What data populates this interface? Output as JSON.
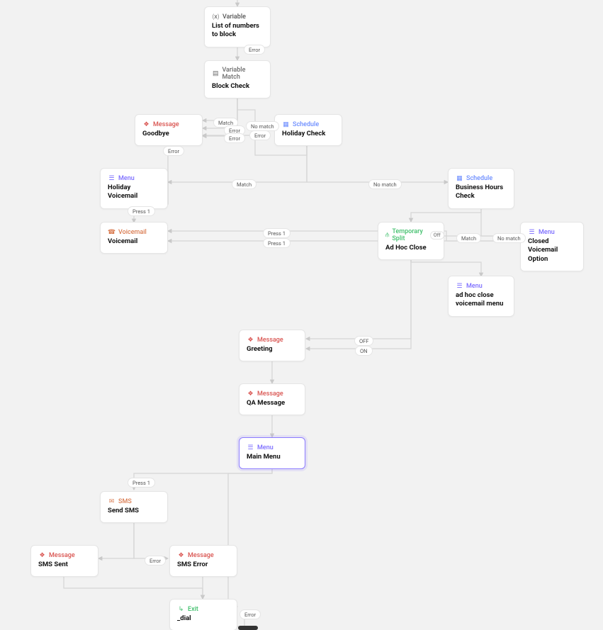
{
  "nodes": {
    "var": {
      "type": "Variable",
      "title": "List of numbers to block",
      "typeClass": "c-variable",
      "icon": "variable-icon"
    },
    "vmatch": {
      "type": "Variable Match",
      "title": "Block Check",
      "typeClass": "c-vmatch",
      "icon": "vmatch-icon"
    },
    "goodbye": {
      "type": "Message",
      "title": "Goodbye",
      "typeClass": "c-message",
      "icon": "message-icon"
    },
    "holiday": {
      "type": "Schedule",
      "title": "Holiday Check",
      "typeClass": "c-schedule",
      "icon": "schedule-icon"
    },
    "hvm": {
      "type": "Menu",
      "title": "Holiday Voicemail",
      "typeClass": "c-menu",
      "icon": "menu-icon"
    },
    "bhc": {
      "type": "Schedule",
      "title": "Business Hours Check",
      "typeClass": "c-schedule",
      "icon": "schedule-icon"
    },
    "vm": {
      "type": "Voicemail",
      "title": "Voicemail",
      "typeClass": "c-voicemail",
      "icon": "voicemail-icon"
    },
    "adhoc": {
      "type": "Temporary Split",
      "title": "Ad Hoc Close",
      "typeClass": "c-split",
      "icon": "split-icon",
      "toggle": "Off"
    },
    "cvo": {
      "type": "Menu",
      "title": "Closed Voicemail Option",
      "typeClass": "c-menu",
      "icon": "menu-icon"
    },
    "adhocmenu": {
      "type": "Menu",
      "title": "ad hoc close voicemail menu",
      "typeClass": "c-menu",
      "icon": "menu-icon"
    },
    "greet": {
      "type": "Message",
      "title": "Greeting",
      "typeClass": "c-message",
      "icon": "message-icon"
    },
    "qa": {
      "type": "Message",
      "title": "QA Message",
      "typeClass": "c-message",
      "icon": "message-icon"
    },
    "main": {
      "type": "Menu",
      "title": "Main Menu",
      "typeClass": "c-menu",
      "icon": "menu-icon",
      "selected": true
    },
    "sms": {
      "type": "SMS",
      "title": "Send SMS",
      "typeClass": "c-sms",
      "icon": "sms-icon"
    },
    "smssent": {
      "type": "Message",
      "title": "SMS Sent",
      "typeClass": "c-message",
      "icon": "message-icon"
    },
    "smserr": {
      "type": "Message",
      "title": "SMS Error",
      "typeClass": "c-message",
      "icon": "message-icon"
    },
    "exit": {
      "type": "Exit",
      "title": "_dial",
      "typeClass": "c-exit",
      "icon": "exit-icon"
    }
  },
  "chips": {
    "err1": "Error",
    "match1": "Match",
    "nomatch1": "No match",
    "err2": "Error",
    "err3": "Error",
    "err4": "Error",
    "errHvm": "Error",
    "matchHoliday": "Match",
    "nomatchHoliday": "No match",
    "press1a": "Press 1",
    "press1b": "Press 1",
    "press1c": "Press 1",
    "matchBhc": "Match",
    "nomatchBhc": "No match",
    "off": "OFF",
    "on": "ON",
    "press1d": "Press 1",
    "errSms": "Error",
    "errExit": "Error"
  }
}
